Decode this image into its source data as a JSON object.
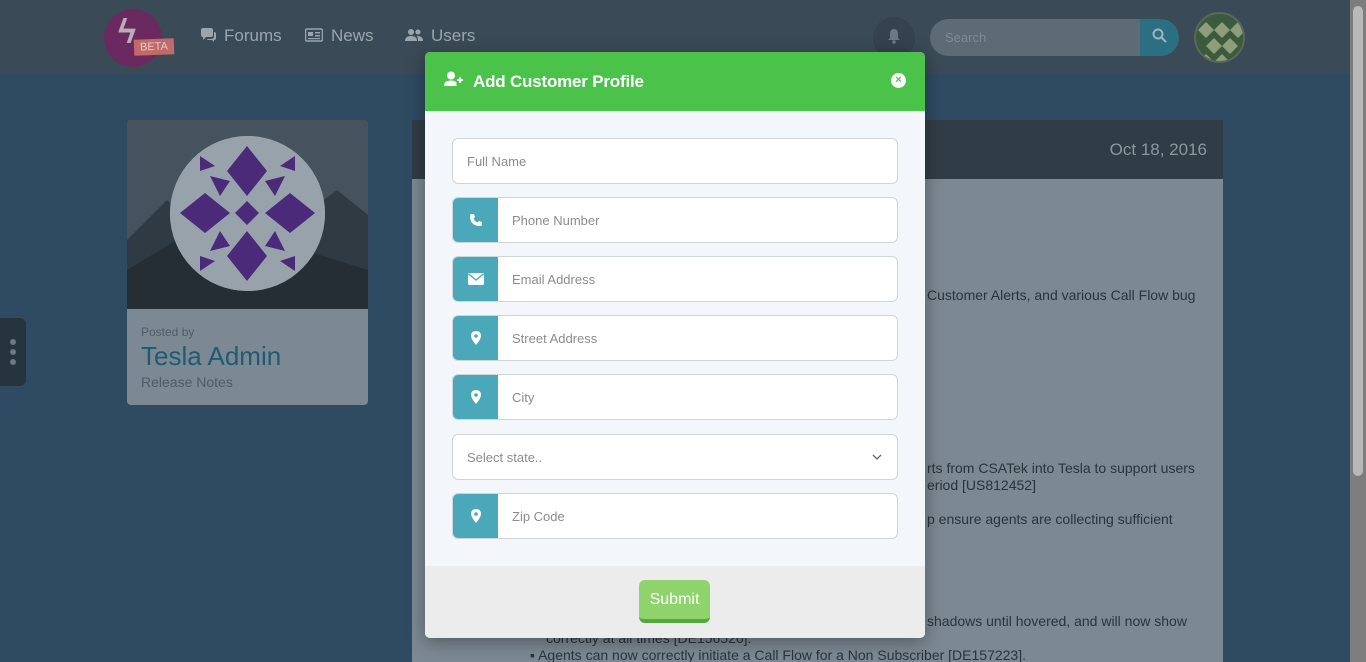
{
  "nav": {
    "logo_badge": "BETA",
    "items": [
      {
        "label": "Forums",
        "icon": "comments-icon"
      },
      {
        "label": "News",
        "icon": "newspaper-icon"
      },
      {
        "label": "Users",
        "icon": "users-icon"
      }
    ],
    "search_placeholder": "Search"
  },
  "post": {
    "date": "Oct 18, 2016",
    "posted_by": "Posted by",
    "author": "Tesla Admin",
    "category": "Release Notes",
    "fragments": [
      "Customer Alerts, and various Call Flow bug",
      "rts from CSATek into Tesla to support users",
      "eriod [US812452]",
      "p ensure agents are collecting sufficient",
      "shadows until hovered, and will now show",
      "correctly at all times [DE156526].",
      "Agents can now correctly initiate a Call Flow for a Non Subscriber [DE157223]."
    ]
  },
  "modal": {
    "title": "Add Customer Profile",
    "close_symbol": "×",
    "fields": {
      "full_name": "Full Name",
      "phone": "Phone Number",
      "email": "Email Address",
      "street": "Street Address",
      "city": "City",
      "state": "Select state..",
      "zip": "Zip Code"
    },
    "submit_label": "Submit"
  },
  "colors": {
    "header_green": "#4bc34b",
    "addon_teal": "#4aa8b8",
    "submit_green": "#8fd36d"
  }
}
